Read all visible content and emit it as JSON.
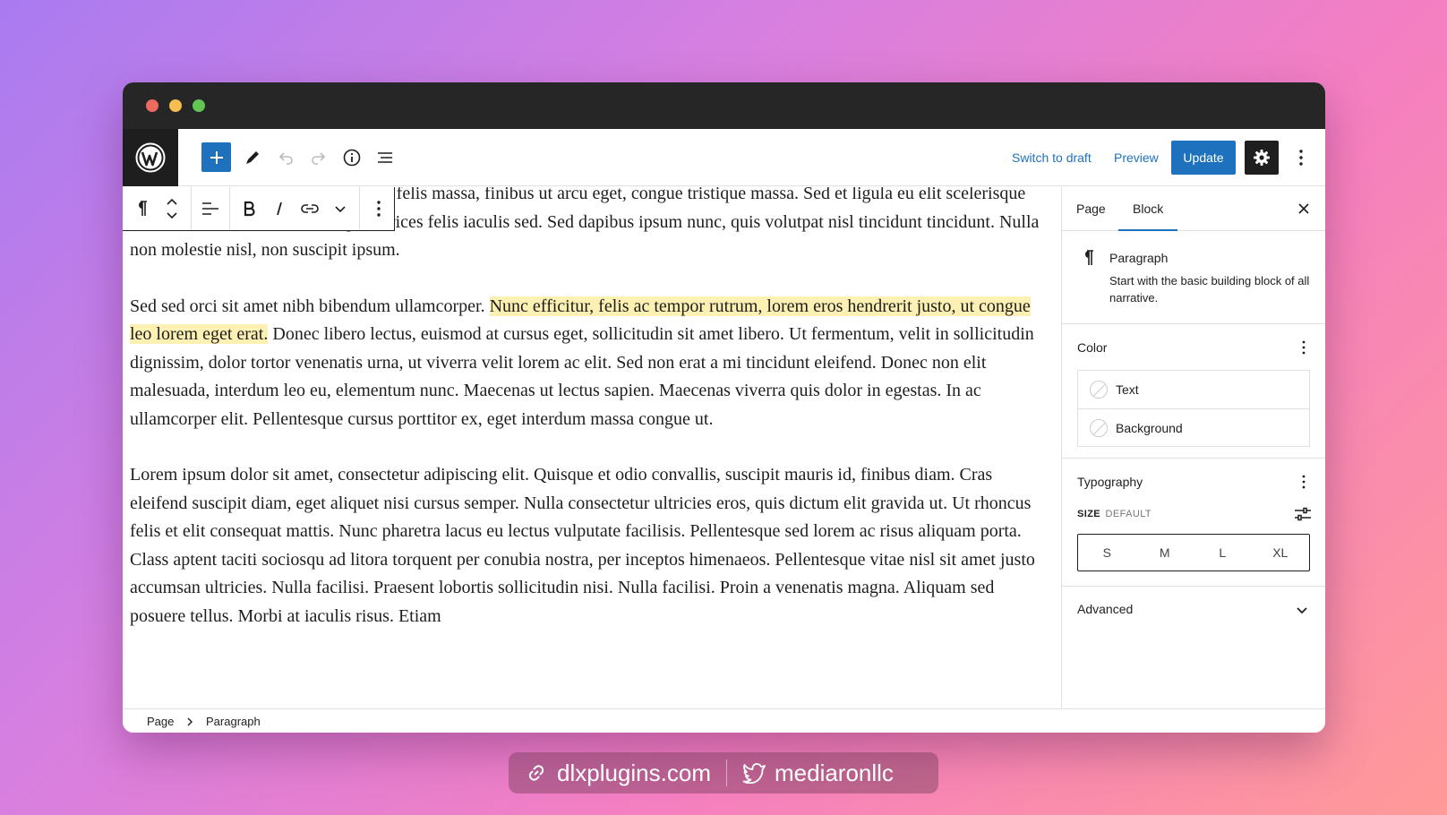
{
  "header": {
    "switch_to_draft": "Switch to draft",
    "preview": "Preview",
    "update": "Update"
  },
  "editor": {
    "paragraphs": [
      "Nam pharetra a velit ac suscipit. Sed felis massa, finibus ut arcu eget, congue tristique massa. Sed et ligula eu elit scelerisque auctor. In facilisis felis eros, eget ultrices felis iaculis sed. Sed dapibus ipsum nunc, quis volutpat nisl tincidunt tincidunt. Nulla non molestie nisl, non suscipit ipsum.",
      "Lorem ipsum dolor sit amet, consectetur adipiscing elit. Quisque et odio convallis, suscipit mauris id, finibus diam. Cras eleifend suscipit diam, eget aliquet nisi cursus semper. Nulla consectetur ultricies eros, quis dictum elit gravida ut. Ut rhoncus felis et elit consequat mattis. Nunc pharetra lacus eu lectus vulputate facilisis. Pellentesque sed lorem ac risus aliquam porta. Class aptent taciti sociosqu ad litora torquent per conubia nostra, per inceptos himenaeos. Pellentesque vitae nisl sit amet justo accumsan ultricies. Nulla facilisi. Praesent lobortis sollicitudin nisi. Nulla facilisi. Proin a venenatis magna. Aliquam sed posuere tellus. Morbi at iaculis risus. Etiam"
    ],
    "p2_before": "Sed sed orci sit amet nibh bibendum ullamcorper. ",
    "p2_highlight": "Nunc efficitur, felis ac tempor rutrum, lorem eros hendrerit justo, ut congue leo lorem eget erat.",
    "p2_after": " Donec libero lectus, euismod at cursus eget, sollicitudin sit amet libero. Ut fermentum, velit in sollicitudin dignissim, dolor tortor venenatis urna, ut viverra velit lorem ac elit. Sed non erat a mi tincidunt eleifend. Donec non elit malesuada, interdum leo eu, elementum nunc. Maecenas ut lectus sapien. Maecenas viverra quis dolor in egestas. In ac ullamcorper elit. Pellentesque cursus porttitor ex, eget interdum massa congue ut."
  },
  "sidebar": {
    "tabs": [
      "Page",
      "Block"
    ],
    "block_name": "Paragraph",
    "block_desc": "Start with the basic building block of all narrative.",
    "color": {
      "title": "Color",
      "items": [
        "Text",
        "Background"
      ]
    },
    "typography": {
      "title": "Typography",
      "size_label": "SIZE",
      "size_value": "DEFAULT",
      "sizes": [
        "S",
        "M",
        "L",
        "XL"
      ]
    },
    "advanced": "Advanced"
  },
  "footer": {
    "crumbs": [
      "Page",
      "Paragraph"
    ]
  },
  "overlay": {
    "site": "dlxplugins.com",
    "handle": "mediaronllc"
  }
}
